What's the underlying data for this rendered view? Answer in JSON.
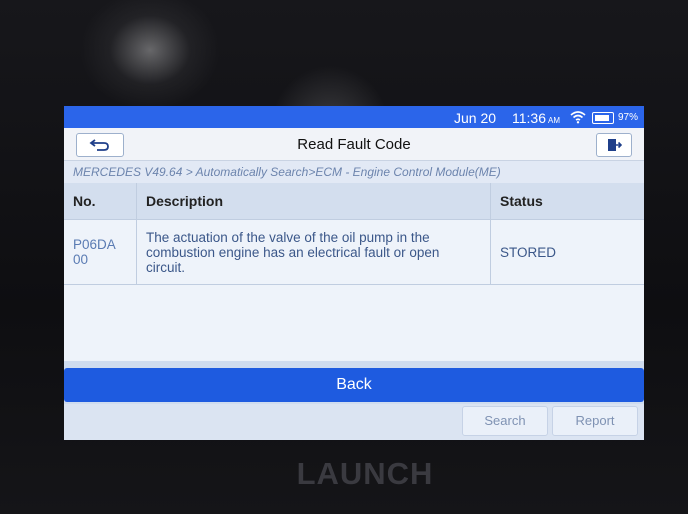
{
  "status_bar": {
    "date": "Jun 20",
    "time": "11:36",
    "ampm": "AM",
    "battery": "97%"
  },
  "header": {
    "title": "Read Fault Code",
    "back_icon": "back-arrow-icon",
    "exit_icon": "exit-icon"
  },
  "breadcrumb": "MERCEDES V49.64 > Automatically Search>ECM - Engine Control Module(ME)",
  "table": {
    "columns": [
      "No.",
      "Description",
      "Status"
    ],
    "rows": [
      {
        "code": "P06DA 00",
        "description": "The actuation of the valve of the oil pump in the combustion engine has an electrical fault or open circuit.",
        "status": "STORED"
      }
    ]
  },
  "actions": {
    "back_label": "Back",
    "search_label": "Search",
    "report_label": "Report"
  },
  "device": {
    "brand": "LAUNCH"
  },
  "colors": {
    "accent": "#2b65ea",
    "back_bar": "#1e5be0",
    "screen_bg": "#cfdcef"
  }
}
